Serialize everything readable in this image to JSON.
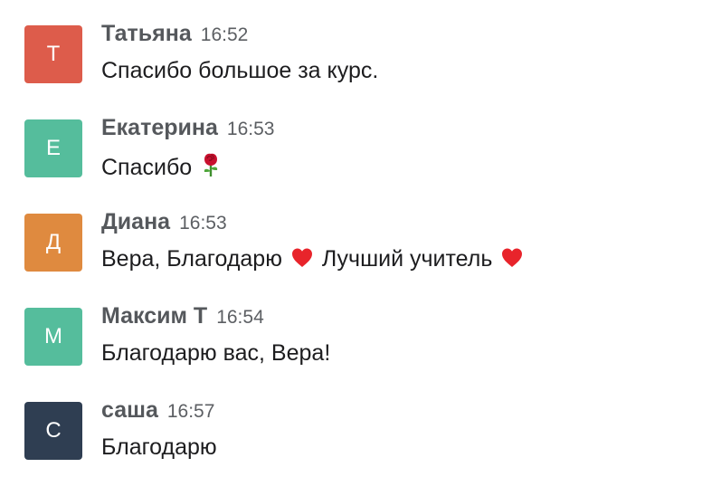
{
  "messages": [
    {
      "author": "Татьяна",
      "time": "16:52",
      "initial": "Т",
      "avatar_color": "#dd5c4b",
      "parts": [
        "Спасибо большое за курс."
      ]
    },
    {
      "author": "Екатерина",
      "time": "16:53",
      "initial": "Е",
      "avatar_color": "#55bd9c",
      "parts": [
        "Спасибо"
      ],
      "emojis": [
        "rose-emoji"
      ]
    },
    {
      "author": "Диана",
      "time": "16:53",
      "initial": "Д",
      "avatar_color": "#df8a3f",
      "parts": [
        "Вера, Благодарю",
        "Лучший учитель"
      ],
      "emojis": [
        "red-heart-emoji",
        "red-heart-emoji"
      ]
    },
    {
      "author": "Максим Т",
      "time": "16:54",
      "initial": "М",
      "avatar_color": "#55bd9c",
      "parts": [
        "Благодарю вас, Вера!"
      ]
    },
    {
      "author": "саша",
      "time": "16:57",
      "initial": "С",
      "avatar_color": "#2f3e52",
      "parts": [
        "Благодарю"
      ]
    }
  ]
}
